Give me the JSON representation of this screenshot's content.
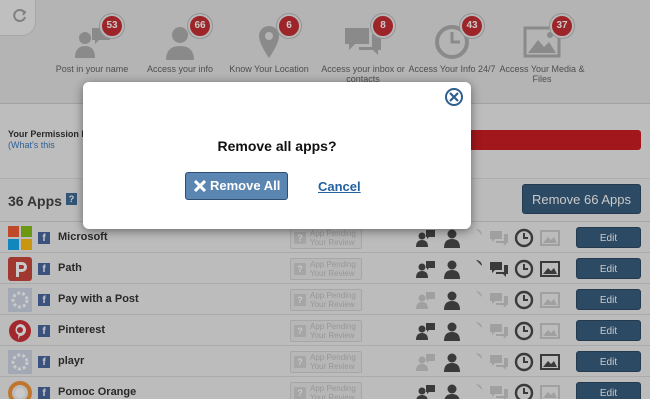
{
  "permissions": [
    {
      "count": "53",
      "label": "Post in your name",
      "icon": "speech-person-icon"
    },
    {
      "count": "66",
      "label": "Access your info",
      "icon": "person-icon"
    },
    {
      "count": "6",
      "label": "Know Your Location",
      "icon": "location-pin-icon"
    },
    {
      "count": "8",
      "label": "Access your inbox or contacts",
      "icon": "chat-bubbles-icon"
    },
    {
      "count": "43",
      "label": "Access Your Info 24/7",
      "icon": "clock-icon"
    },
    {
      "count": "37",
      "label": "Access Your Media & Files",
      "icon": "image-icon"
    }
  ],
  "meter": {
    "label": "Your Permission Meter",
    "link": "(What's this"
  },
  "apps_header": {
    "count_label": "36 Apps",
    "help": "?",
    "remove_button": "Remove 66 Apps"
  },
  "apps": [
    {
      "name": "Microsoft",
      "logo": "microsoft-logo",
      "pending": "App Pending Your Review",
      "edit": "Edit",
      "perms": [
        1,
        1,
        0,
        0,
        1,
        0
      ]
    },
    {
      "name": "Path",
      "logo": "path-logo",
      "pending": "App Pending Your Review",
      "edit": "Edit",
      "perms": [
        1,
        1,
        1,
        1,
        1,
        1
      ]
    },
    {
      "name": "Pay with a Post",
      "logo": "generic-app-logo",
      "pending": "App Pending Your Review",
      "edit": "Edit",
      "perms": [
        0,
        1,
        0,
        0,
        1,
        0
      ]
    },
    {
      "name": "Pinterest",
      "logo": "pinterest-logo",
      "pending": "App Pending Your Review",
      "edit": "Edit",
      "perms": [
        1,
        1,
        0,
        0,
        1,
        0
      ]
    },
    {
      "name": "playr",
      "logo": "generic-app-logo",
      "pending": "App Pending Your Review",
      "edit": "Edit",
      "perms": [
        0,
        1,
        0,
        0,
        1,
        1
      ]
    },
    {
      "name": "Pomoc Orange",
      "logo": "pomoc-orange-logo",
      "pending": "App Pending Your Review",
      "edit": "Edit",
      "perms": [
        1,
        1,
        0,
        0,
        1,
        0
      ]
    }
  ],
  "dialog": {
    "message": "Remove all apps?",
    "confirm": "Remove All",
    "cancel": "Cancel"
  },
  "colors": {
    "accent": "#264f74",
    "badge": "#c21d22",
    "meter": "#c8090e",
    "facebook": "#3b5998"
  }
}
